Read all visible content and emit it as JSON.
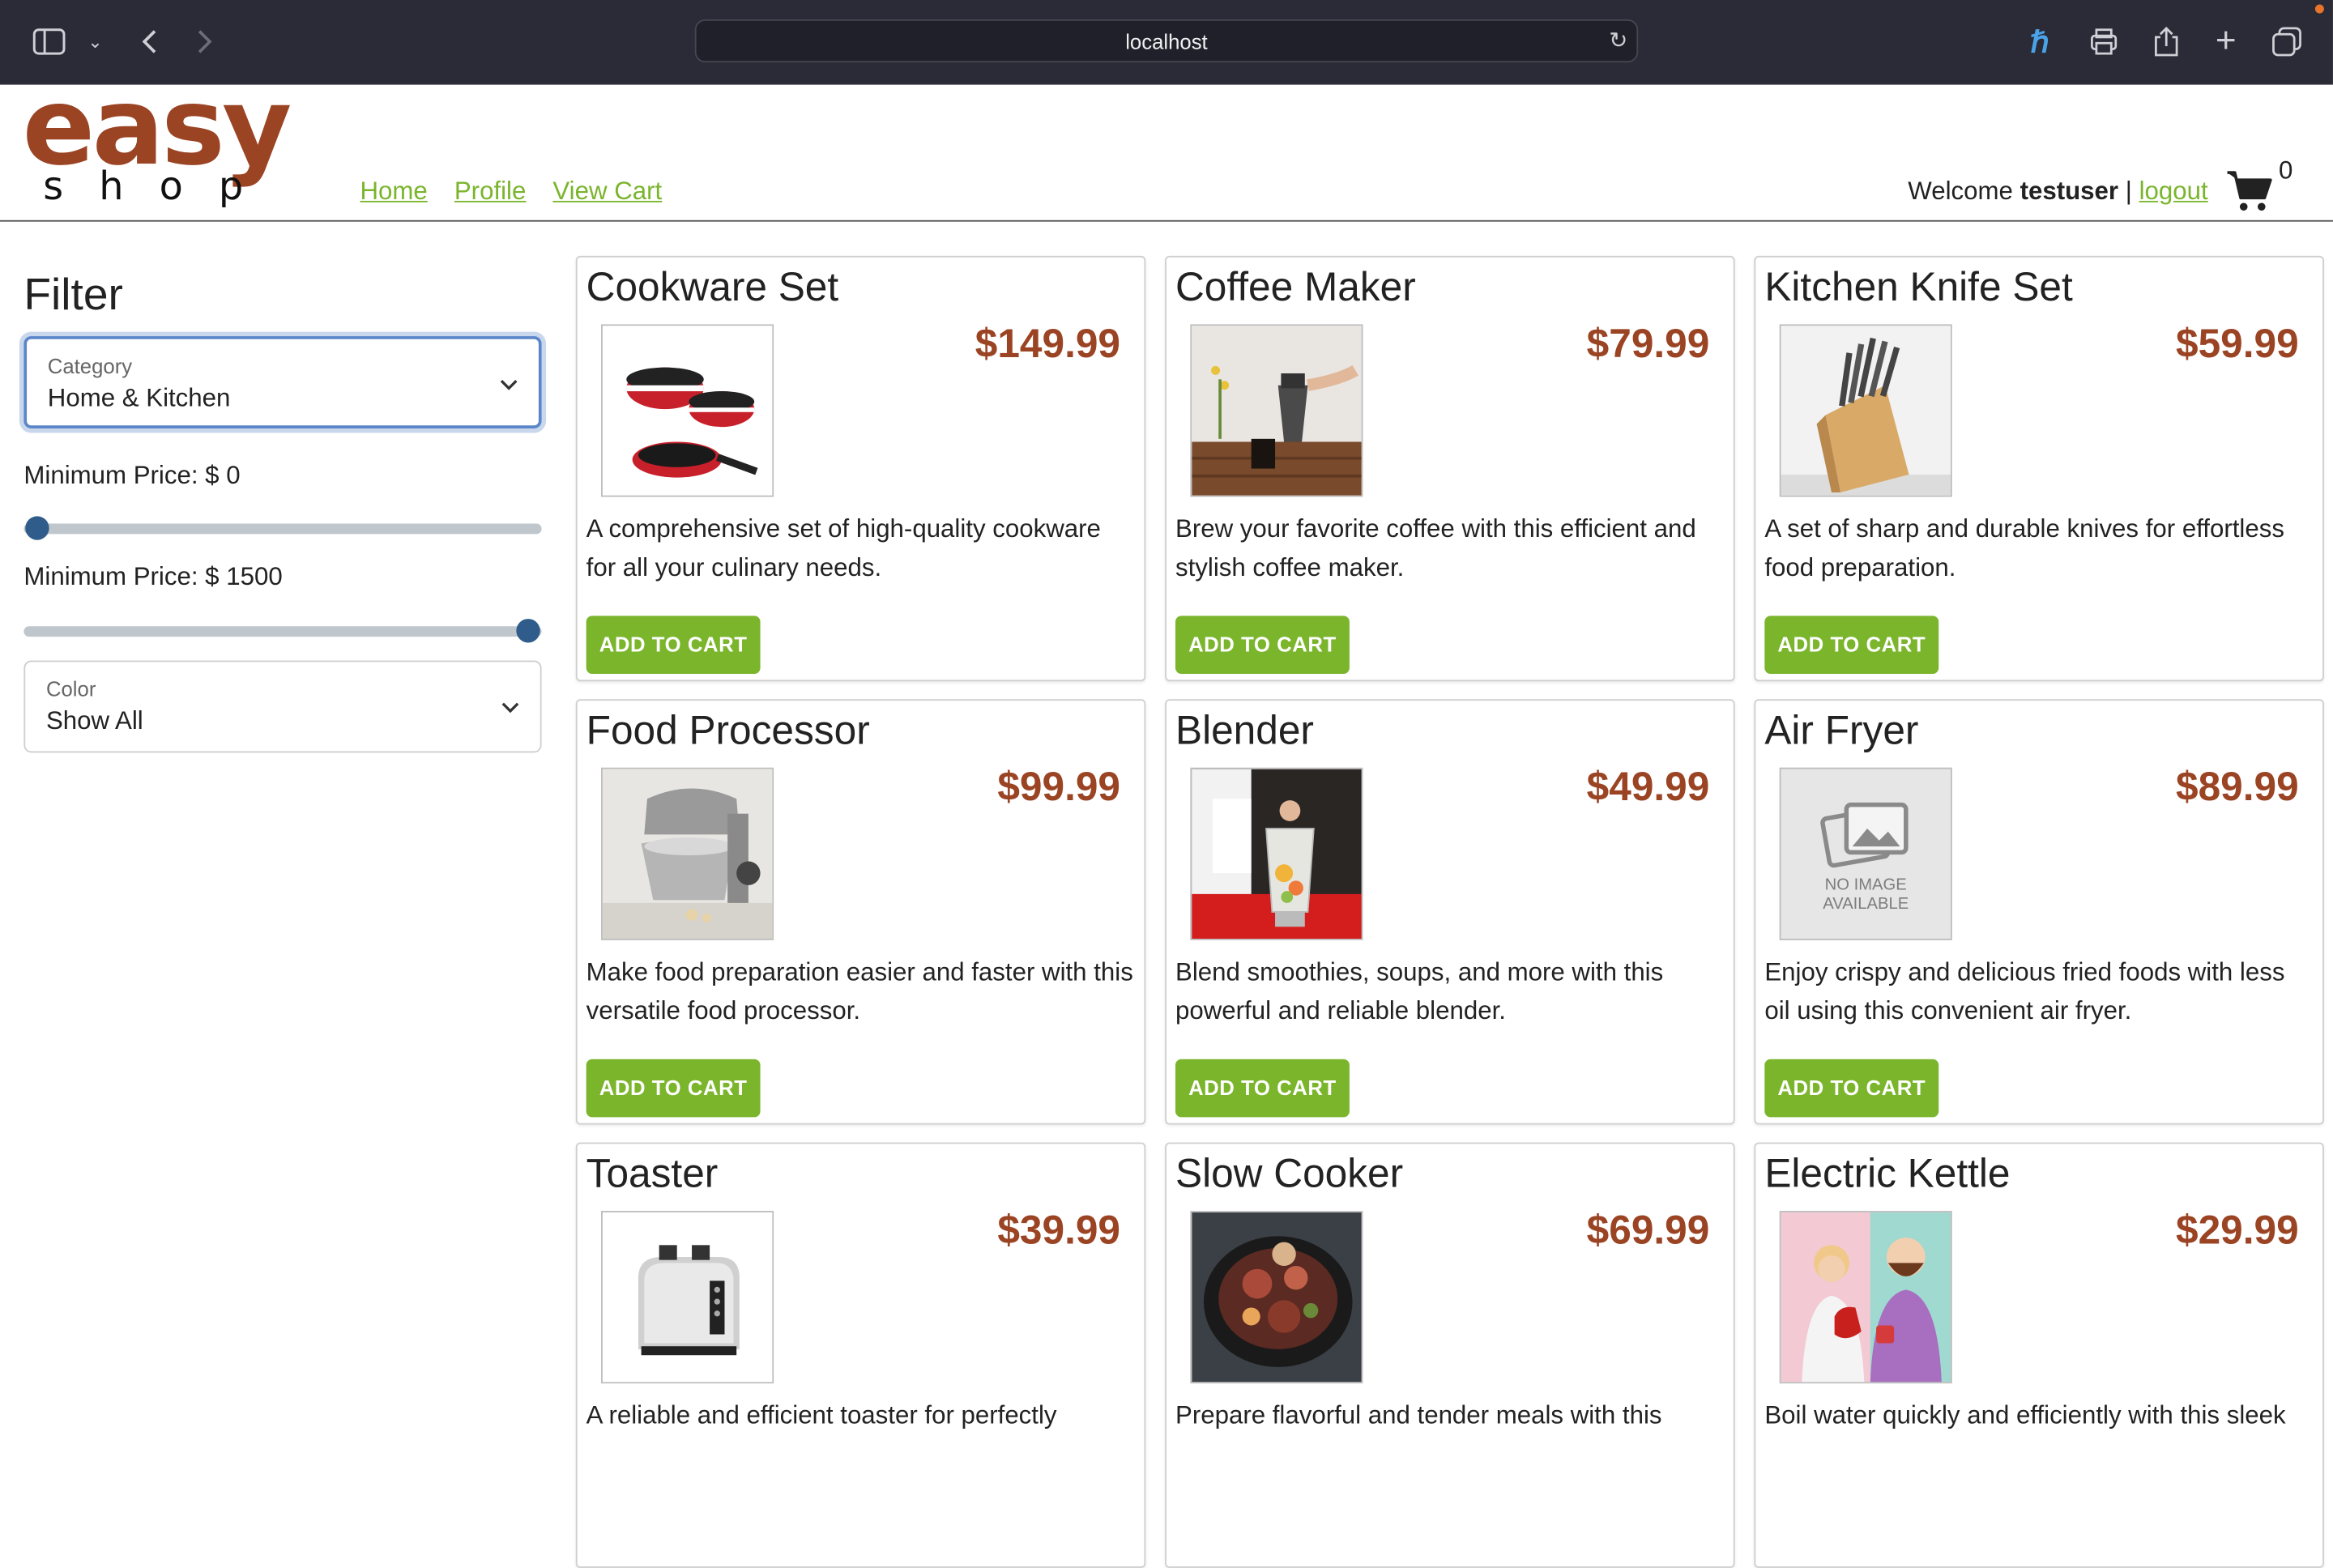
{
  "browser": {
    "url": "localhost"
  },
  "logo": {
    "big": "easy",
    "small": "shop"
  },
  "nav": {
    "home": "Home",
    "profile": "Profile",
    "view_cart": "View Cart"
  },
  "user": {
    "welcome": "Welcome",
    "username": "testuser",
    "separator": "|",
    "logout": "logout",
    "cart_count": "0"
  },
  "filter": {
    "title": "Filter",
    "category": {
      "label": "Category",
      "value": "Home & Kitchen"
    },
    "min_price": {
      "label": "Minimum Price: $ 0",
      "value_fraction": 0.0
    },
    "max_price": {
      "label": "Minimum Price: $ 1500",
      "value_fraction": 1.0
    },
    "color": {
      "label": "Color",
      "value": "Show All"
    }
  },
  "add_to_cart_label": "ADD TO CART",
  "products": [
    {
      "name": "Cookware Set",
      "price": "$149.99",
      "description": "A comprehensive set of high-quality cookware for all your culinary needs.",
      "image": "cookware"
    },
    {
      "name": "Coffee Maker",
      "price": "$79.99",
      "description": "Brew your favorite coffee with this efficient and stylish coffee maker.",
      "image": "coffee"
    },
    {
      "name": "Kitchen Knife Set",
      "price": "$59.99",
      "description": "A set of sharp and durable knives for effortless food preparation.",
      "image": "knives"
    },
    {
      "name": "Food Processor",
      "price": "$99.99",
      "description": "Make food preparation easier and faster with this versatile food processor.",
      "image": "processor"
    },
    {
      "name": "Blender",
      "price": "$49.99",
      "description": "Blend smoothies, soups, and more with this powerful and reliable blender.",
      "image": "blender"
    },
    {
      "name": "Air Fryer",
      "price": "$89.99",
      "description": "Enjoy crispy and delicious fried foods with less oil using this convenient air fryer.",
      "image": "no-image",
      "no_image_text": [
        "NO IMAGE",
        "AVAILABLE"
      ]
    },
    {
      "name": "Toaster",
      "price": "$39.99",
      "description": "A reliable and efficient toaster for perfectly",
      "image": "toaster"
    },
    {
      "name": "Slow Cooker",
      "price": "$69.99",
      "description": "Prepare flavorful and tender meals with this",
      "image": "slowcooker"
    },
    {
      "name": "Electric Kettle",
      "price": "$29.99",
      "description": "Boil water quickly and efficiently with this sleek",
      "image": "kettle"
    }
  ]
}
